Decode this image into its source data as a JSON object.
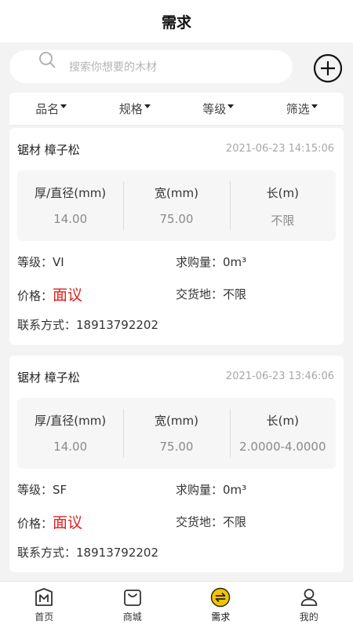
{
  "header": {
    "title": "需求"
  },
  "search": {
    "placeholder": "搜索你想要的木材"
  },
  "filters": [
    {
      "label": "品名"
    },
    {
      "label": "规格"
    },
    {
      "label": "等级"
    },
    {
      "label": "筛选"
    }
  ],
  "labels": {
    "thickness": "厚/直径(mm)",
    "width": "宽(mm)",
    "length": "长(m)",
    "grade": "等级：",
    "quantity": "求购量：",
    "price": "价格：",
    "delivery": "交货地：",
    "contact": "联系方式："
  },
  "items": [
    {
      "title": "锯材 樟子松",
      "time": "2021-06-23 14:15:06",
      "thickness": "14.00",
      "width": "75.00",
      "length": "不限",
      "grade": "VI",
      "quantity": "0m³",
      "price": "面议",
      "delivery": "不限",
      "contact": "18913792202"
    },
    {
      "title": "锯材 樟子松",
      "time": "2021-06-23 13:46:06",
      "thickness": "14.00",
      "width": "75.00",
      "length": "2.0000-4.0000",
      "grade": "SF",
      "quantity": "0m³",
      "price": "面议",
      "delivery": "不限",
      "contact": "18913792202"
    }
  ],
  "tabs": [
    {
      "label": "首页",
      "icon": "home-icon"
    },
    {
      "label": "商城",
      "icon": "shop-bag-icon"
    },
    {
      "label": "需求",
      "icon": "demand-exchange-icon"
    },
    {
      "label": "我的",
      "icon": "user-icon"
    }
  ],
  "colors": {
    "price": "#e02020",
    "active_tab": "#f5c400"
  }
}
